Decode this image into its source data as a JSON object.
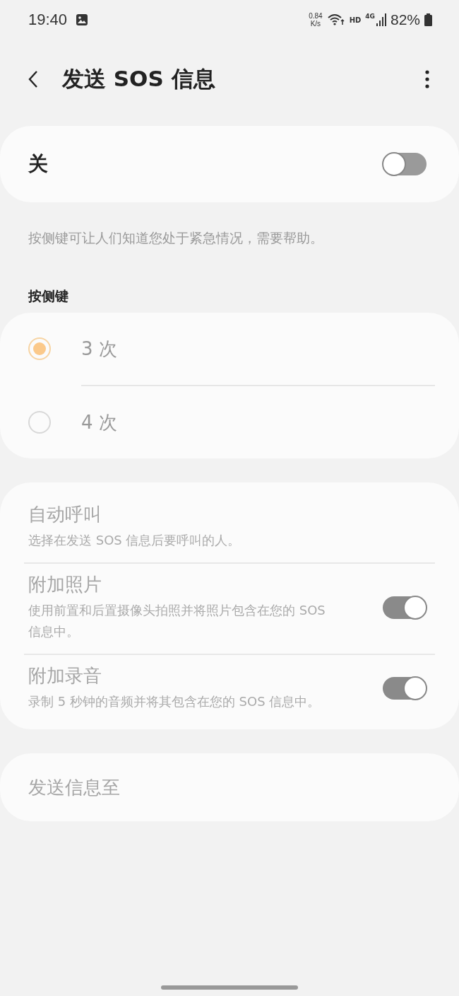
{
  "status_bar": {
    "time": "19:40",
    "net_speed": "0.84",
    "net_unit": "K/s",
    "hd": "HD",
    "network": "4G",
    "battery": "82%"
  },
  "header": {
    "title": "发送 SOS 信息"
  },
  "master": {
    "label": "关",
    "on": false
  },
  "description": "按侧键可让人们知道您处于紧急情况，需要帮助。",
  "press_section": {
    "heading": "按侧键",
    "disabled": true,
    "options": [
      {
        "label": "3 次",
        "selected": true
      },
      {
        "label": "4 次",
        "selected": false
      }
    ]
  },
  "settings": [
    {
      "kind": "link",
      "title": "自动呼叫",
      "subtitle": "选择在发送 SOS 信息后要呼叫的人。",
      "disabled": true
    },
    {
      "kind": "toggle",
      "title": "附加照片",
      "subtitle": "使用前置和后置摄像头拍照并将照片包含在您的 SOS 信息中。",
      "on": true,
      "disabled": true
    },
    {
      "kind": "toggle",
      "title": "附加录音",
      "subtitle": "录制 5 秒钟的音频并将其包含在您的 SOS 信息中。",
      "on": true,
      "disabled": true
    }
  ],
  "send_to": {
    "label": "发送信息至",
    "disabled": true
  }
}
